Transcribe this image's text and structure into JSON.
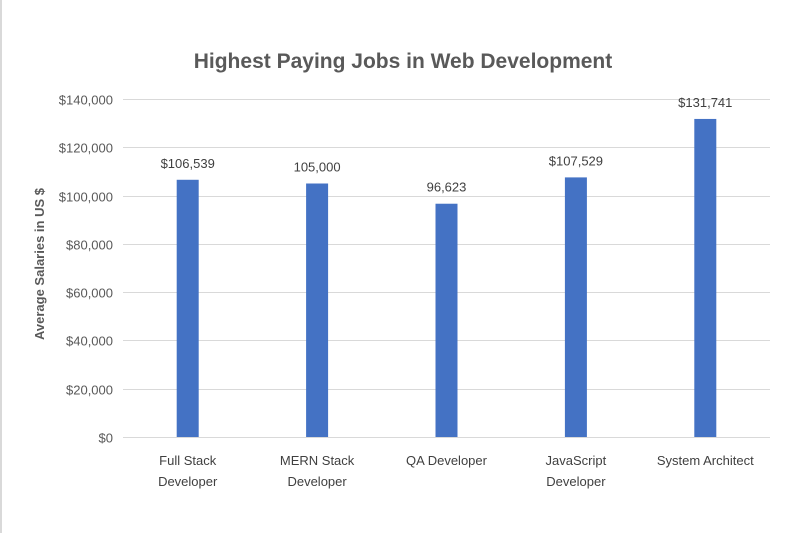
{
  "chart_data": {
    "type": "bar",
    "title": "Highest Paying Jobs in Web Development",
    "xlabel": "",
    "ylabel": "Average Salaries  in  US $",
    "categories": [
      [
        "Full Stack",
        "Developer"
      ],
      [
        "MERN Stack",
        "Developer"
      ],
      [
        "QA Developer"
      ],
      [
        "JavaScript",
        "Developer"
      ],
      [
        "System Architect"
      ]
    ],
    "values": [
      106539,
      105000,
      96623,
      107529,
      131741
    ],
    "data_labels": [
      "$106,539",
      "105,000",
      "96,623",
      "$107,529",
      "$131,741"
    ],
    "ylim": [
      0,
      140000
    ],
    "yticks": [
      0,
      20000,
      40000,
      60000,
      80000,
      100000,
      120000,
      140000
    ],
    "ytick_labels": [
      "$0",
      "$20,000",
      "$40,000",
      "$60,000",
      "$80,000",
      "$100,000",
      "$120,000",
      "$140,000"
    ],
    "grid": true,
    "legend": "none",
    "colors": {
      "bar": "#4472c4",
      "grid": "#d9d9d9",
      "text": "#595959"
    }
  }
}
